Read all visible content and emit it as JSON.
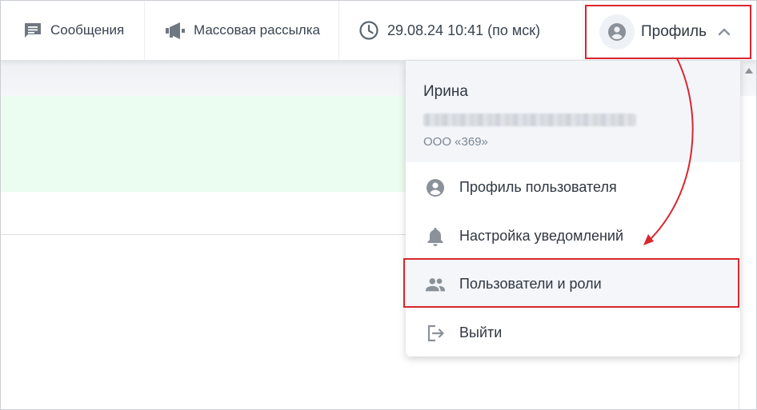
{
  "topbar": {
    "messages_label": "Сообщения",
    "mailing_label": "Массовая рассылка",
    "datetime_label": "29.08.24 10:41 (по мск)",
    "profile_label": "Профиль"
  },
  "profile_menu": {
    "user_name": "Ирина",
    "organization": "ООО «369»",
    "items": [
      {
        "label": "Профиль пользователя",
        "icon": "account-circle-icon"
      },
      {
        "label": "Настройка уведомлений",
        "icon": "bell-icon"
      },
      {
        "label": "Пользователи и роли",
        "icon": "people-icon"
      },
      {
        "label": "Выйти",
        "icon": "logout-icon"
      }
    ]
  },
  "colors": {
    "highlight": "#d9262f",
    "icon": "#8b9199",
    "text": "#2f3742",
    "muted": "#7c8693",
    "green_panel": "#ebfdf0",
    "menu_header": "#f3f5f9"
  }
}
